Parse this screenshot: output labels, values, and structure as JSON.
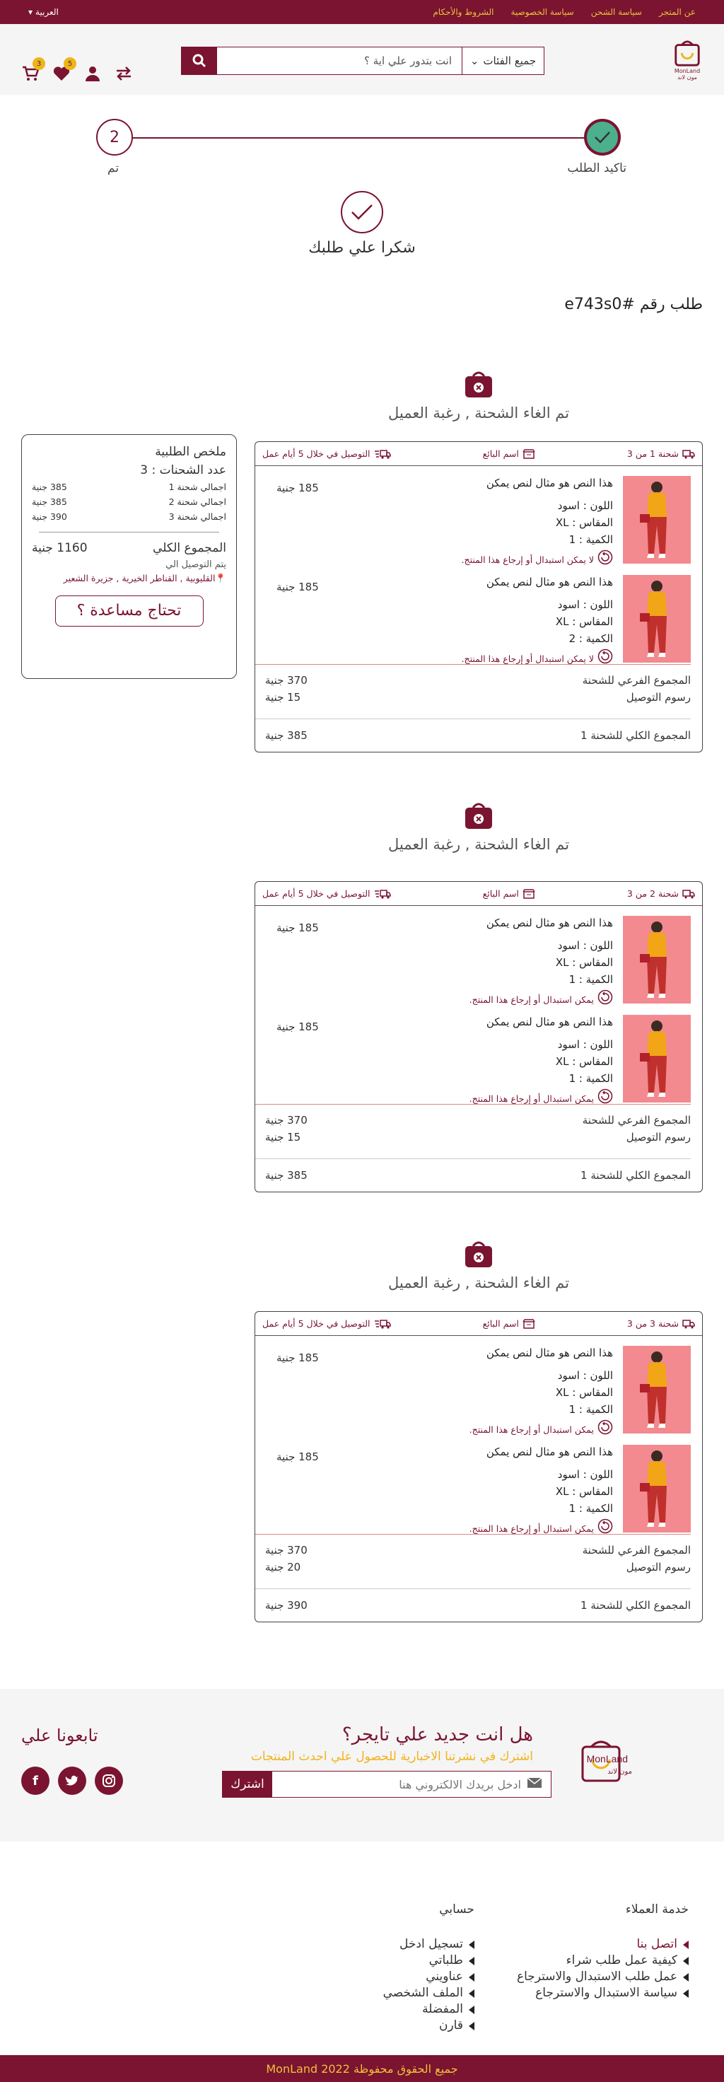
{
  "topbar": {
    "links": [
      "عن المتجر",
      "سياسة الشحن",
      "سياسة الخصوصية",
      "الشروط والأحكام"
    ],
    "language": "العربية"
  },
  "header": {
    "logo_text": "MonLand",
    "logo_subtext": "مون لاند",
    "category_select": "جميع الفئات",
    "search_placeholder": "انت بتدور علي اية ؟",
    "wishlist_count": "5",
    "cart_count": "3"
  },
  "progress": {
    "step1_label": "تاكيد الطلب",
    "step2_number": "2",
    "step2_label": "تم"
  },
  "thanks": {
    "message": "شكرا علي طلبك",
    "order_number": "طلب رقم #e743s0"
  },
  "summary": {
    "title": "ملخص الطلبية",
    "shipments_count": "عدد الشحنات : 3",
    "rows": [
      {
        "label": "اجمالي شحنة 1",
        "value": "385 جنية"
      },
      {
        "label": "اجمالي شحنة 2",
        "value": "385 جنية"
      },
      {
        "label": "اجمالي شحنة 3",
        "value": "390 جنية"
      }
    ],
    "total_label": "المجموع الكلي",
    "total_value": "1160 جنية",
    "deliver_to": "يتم التوصيل الي",
    "address": "القليوبية , القناطر الخيرية , جزيرة الشعير",
    "help_button": "تحتاج مساعدة ؟"
  },
  "shipments": [
    {
      "cancel_msg": "تم الغاء الشحنة , رغبة العميل",
      "label": "شحنة 1 من 3",
      "seller": "اسم البائع",
      "delivery": "التوصيل في خلال 5 أيام عمل",
      "items": [
        {
          "title": "هذا النص هو مثال لنص يمكن",
          "color": "اللون : اسود",
          "size": "المقاس : XL",
          "qty": "الكمية : 1",
          "note": "لا يمكن استبدال أو إرجاع هذا المنتج.",
          "price": "185 جنية"
        },
        {
          "title": "هذا النص هو مثال لنص يمكن",
          "color": "اللون : اسود",
          "size": "المقاس : XL",
          "qty": "الكمية : 2",
          "note": "لا يمكن استبدال أو إرجاع هذا المنتج.",
          "price": "185 جنية"
        }
      ],
      "subtotal_label": "المجموع الفرعي للشحنة",
      "subtotal": "370 جنية",
      "delivery_label": "رسوم التوصيل",
      "delivery_fee": "15 جنية",
      "total_label": "المجموع الكلي للشحنة 1",
      "total": "385 جنية"
    },
    {
      "cancel_msg": "تم الغاء الشحنة , رغبة العميل",
      "label": "شحنة 2 من 3",
      "seller": "اسم البائع",
      "delivery": "التوصيل في خلال 5 أيام عمل",
      "items": [
        {
          "title": "هذا النص هو مثال لنص يمكن",
          "color": "اللون : اسود",
          "size": "المقاس : XL",
          "qty": "الكمية : 1",
          "note": "يمكن استبدال أو إرجاع هذا المنتج.",
          "price": "185 جنية"
        },
        {
          "title": "هذا النص هو مثال لنص يمكن",
          "color": "اللون : اسود",
          "size": "المقاس : XL",
          "qty": "الكمية : 1",
          "note": "يمكن استبدال أو إرجاع هذا المنتج.",
          "price": "185 جنية"
        }
      ],
      "subtotal_label": "المجموع الفرعي للشحنة",
      "subtotal": "370 جنية",
      "delivery_label": "رسوم التوصيل",
      "delivery_fee": "15 جنية",
      "total_label": "المجموع الكلي للشحنة 1",
      "total": "385 جنية"
    },
    {
      "cancel_msg": "تم الغاء الشحنة , رغبة العميل",
      "label": "شحنة 3 من 3",
      "seller": "اسم البائع",
      "delivery": "التوصيل في خلال 5 أيام عمل",
      "items": [
        {
          "title": "هذا النص هو مثال لنص يمكن",
          "color": "اللون : اسود",
          "size": "المقاس : XL",
          "qty": "الكمية : 1",
          "note": "يمكن استبدال أو إرجاع هذا المنتج.",
          "price": "185 جنية"
        },
        {
          "title": "هذا النص هو مثال لنص يمكن",
          "color": "اللون : اسود",
          "size": "المقاس : XL",
          "qty": "الكمية : 1",
          "note": "يمكن استبدال أو إرجاع هذا المنتج.",
          "price": "185 جنية"
        }
      ],
      "subtotal_label": "المجموع الفرعي للشحنة",
      "subtotal": "370 جنية",
      "delivery_label": "رسوم التوصيل",
      "delivery_fee": "20 جنية",
      "total_label": "المجموع الكلي للشحنة 1",
      "total": "390 جنية"
    }
  ],
  "newsletter": {
    "title": "هل انت جديد علي تايجر؟",
    "subtitle": "اشترك في نشرتنا الاخبارية للحصول علي احدث المنتجات",
    "email_placeholder": "ادخل بريدك الالكتروني هنا",
    "subscribe_button": "اشترك",
    "follow_title": "تابعونا علي"
  },
  "footer": {
    "customer_service_title": "خدمة العملاء",
    "customer_service_links": [
      "اتصل بنا",
      "كيفية عمل طلب شراء",
      "عمل طلب الاستبدال والاسترجاع",
      "سياسة الاستبدال والاسترجاع"
    ],
    "account_title": "حسابي",
    "account_links": [
      "تسجيل ادخل",
      "طلباتي",
      "عناويني",
      "الملف الشخصي",
      "المفضلة",
      "قارن"
    ],
    "copyright": "جميع الحقوق محفوظة  MonLand 2022"
  },
  "colors": {
    "brand": "#7a1430",
    "accent": "#f0b31a",
    "success": "#4caf8e"
  }
}
